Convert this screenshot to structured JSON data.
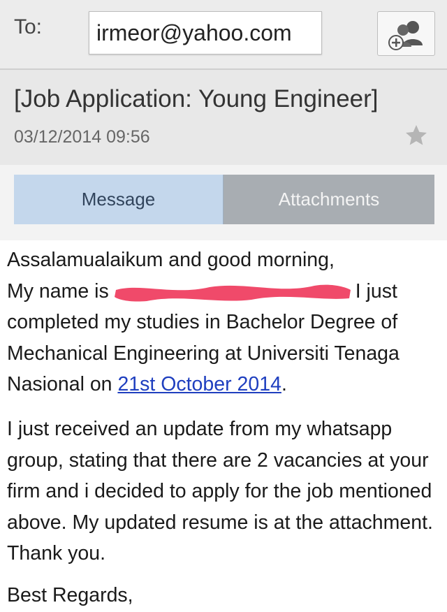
{
  "header": {
    "to_label": "To:",
    "to_value": "irmeor@yahoo.com",
    "contact_icon": "add-contact-icon",
    "subject": "[Job Application: Young Engineer]",
    "date": "03/12/2014",
    "time": "09:56",
    "star_icon": "star-icon"
  },
  "tabs": [
    {
      "label": "Message",
      "active": true
    },
    {
      "label": "Attachments",
      "active": false
    }
  ],
  "message": {
    "greeting": "Assalamualaikum and good morning,",
    "name_prefix": "My name is",
    "name_suffix": "I just",
    "p1_rest": "completed my studies in Bachelor Degree of Mechanical Engineering at Universiti Tenaga Nasional on",
    "date_link": "21st October 2014",
    "p1_end": ".",
    "p2": "I just received an update from my whatsapp group, stating that there are 2 vacancies at your firm and i decided to apply for the job mentioned above. My updated resume is at the attachment. Thank you.",
    "closing": "Best Regards,"
  },
  "colors": {
    "tab_active": "#c4d7ec",
    "tab_inactive": "#a8adb2",
    "link": "#1f3fbf",
    "redaction": "#f04a6a"
  }
}
